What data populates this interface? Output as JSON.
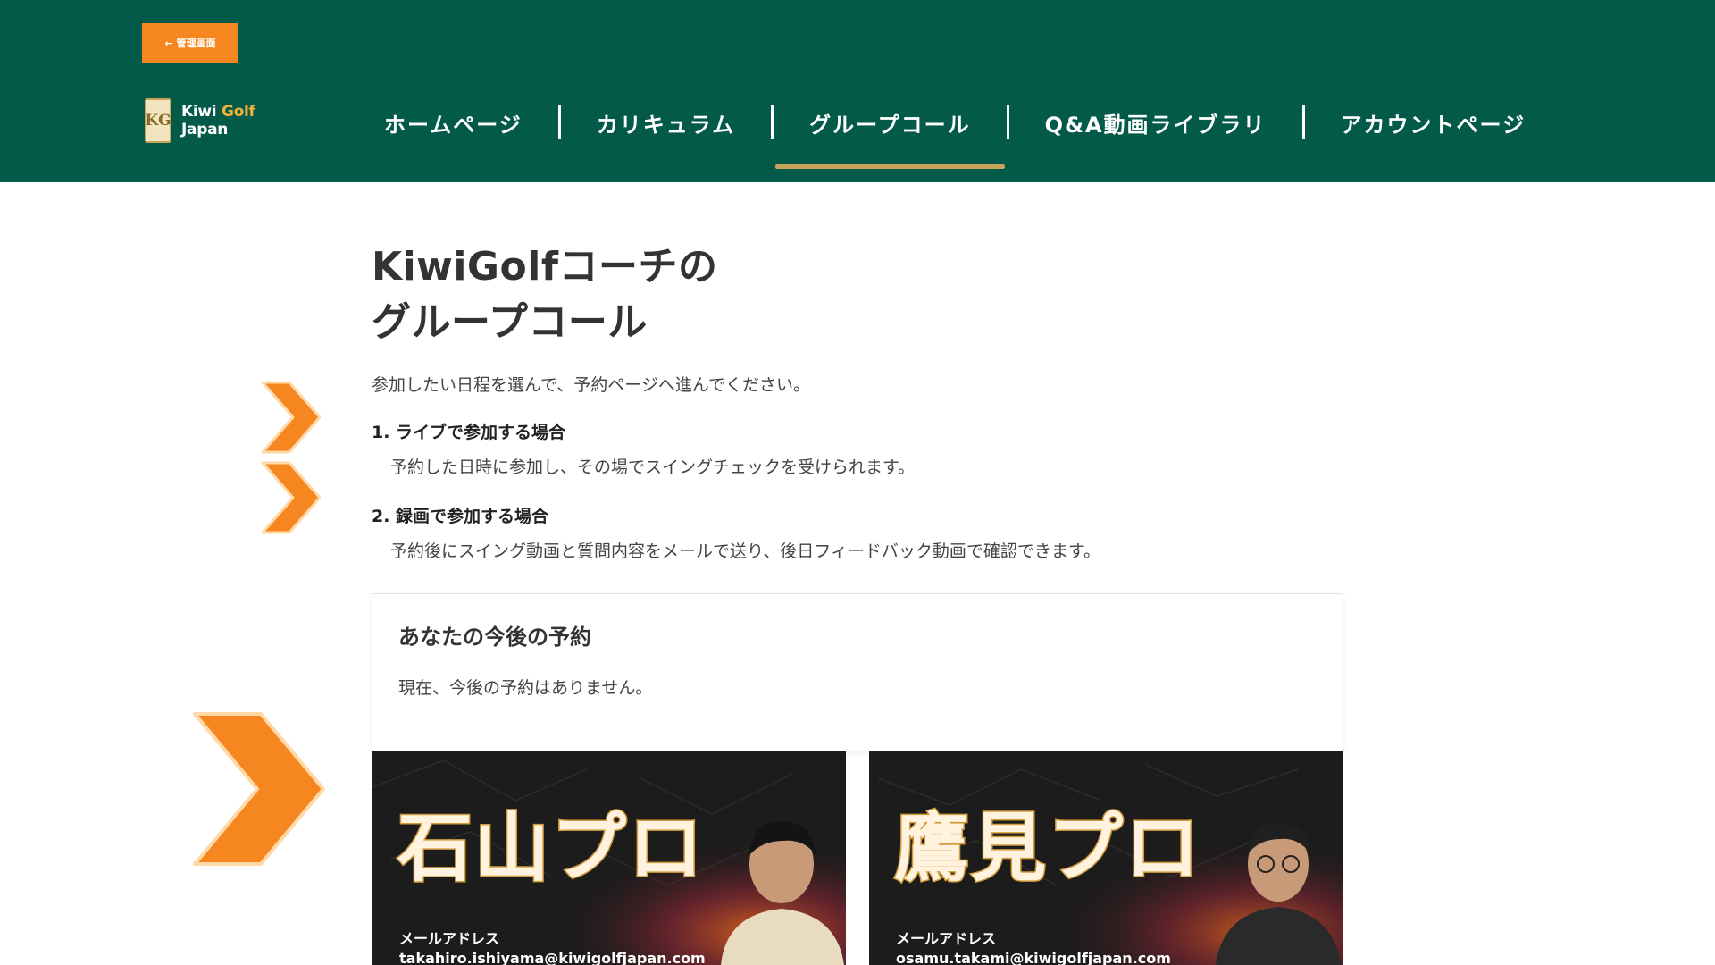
{
  "header": {
    "admin_button": "← 管理画面",
    "logo": {
      "mark": "KG",
      "line1_a": "Kiwi ",
      "line1_b": "Golf",
      "line2": "Japan"
    },
    "nav": [
      {
        "label": "ホームページ"
      },
      {
        "label": "カリキュラム"
      },
      {
        "label": "グループコール",
        "active": true
      },
      {
        "label": "Q&A動画ライブラリ"
      },
      {
        "label": "アカウントページ"
      }
    ]
  },
  "main": {
    "title_line1": "KiwiGolfコーチの",
    "title_line2": "グループコール",
    "intro": "参加したい日程を選んで、予約ページへ進んでください。",
    "steps": [
      {
        "title": "1. ライブで参加する場合",
        "desc": "予約した日時に参加し、その場でスイングチェックを受けられます。"
      },
      {
        "title": "2. 録画で参加する場合",
        "desc": "予約後にスイング動画と質問内容をメールで送り、後日フィードバック動画で確認できます。"
      }
    ],
    "booking": {
      "title": "あなたの今後の予約",
      "empty_text": "現在、今後の予約はありません。"
    },
    "coaches": [
      {
        "name": "石山プロ",
        "email_label": "メールアドレス",
        "email": "takahiro.ishiyama@kiwigolfjapan.com"
      },
      {
        "name": "鷹見プロ",
        "email_label": "メールアドレス",
        "email": "osamu.takami@kiwigolfjapan.com"
      }
    ]
  },
  "colors": {
    "header_bg": "#035a49",
    "accent_orange": "#f58620",
    "nav_underline": "#c9a35a"
  }
}
